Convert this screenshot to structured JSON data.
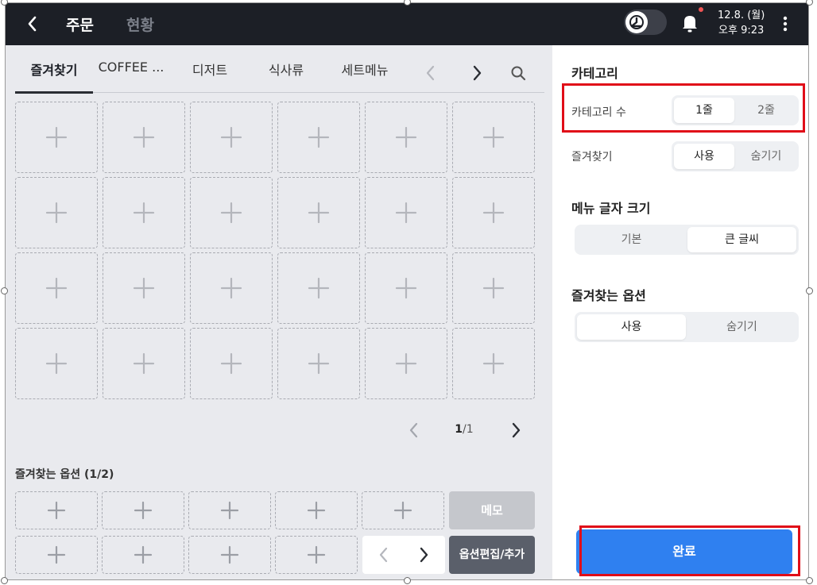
{
  "header": {
    "back_icon": "chevron-left-icon",
    "title_active": "주문",
    "title_inactive": "현황",
    "date": "12.8. (월)",
    "time": "오후 9:23"
  },
  "tabs": {
    "items": [
      "즐겨찾기",
      "COFFEE ...",
      "디저트",
      "식사류",
      "세트메뉴"
    ],
    "active_index": 0
  },
  "grid": {
    "rows": 4,
    "cols": 6
  },
  "pager": {
    "current": "1",
    "separator": "/",
    "total": "1"
  },
  "options": {
    "label": "즐겨찾는 옵션 (1/2)",
    "memo_label": "메모",
    "edit_label": "옵션편집/추가"
  },
  "settings": {
    "category_title": "카테고리",
    "category_count_label": "카테고리 수",
    "category_count_options": [
      "1줄",
      "2줄"
    ],
    "category_count_selected": 0,
    "favorites_label": "즐겨찾기",
    "favorites_options": [
      "사용",
      "숨기기"
    ],
    "favorites_selected": 0,
    "font_size_title": "메뉴 글자 크기",
    "font_size_options": [
      "기본",
      "큰 글씨"
    ],
    "font_size_selected": 1,
    "fav_options_title": "즐겨찾는 옵션",
    "fav_options_options": [
      "사용",
      "숨기기"
    ],
    "fav_options_selected": 0,
    "done_label": "완료"
  },
  "colors": {
    "topbar": "#1c1f26",
    "accent": "#2f80f0",
    "highlight": "#e00d18",
    "notification_dot": "#f05454"
  }
}
